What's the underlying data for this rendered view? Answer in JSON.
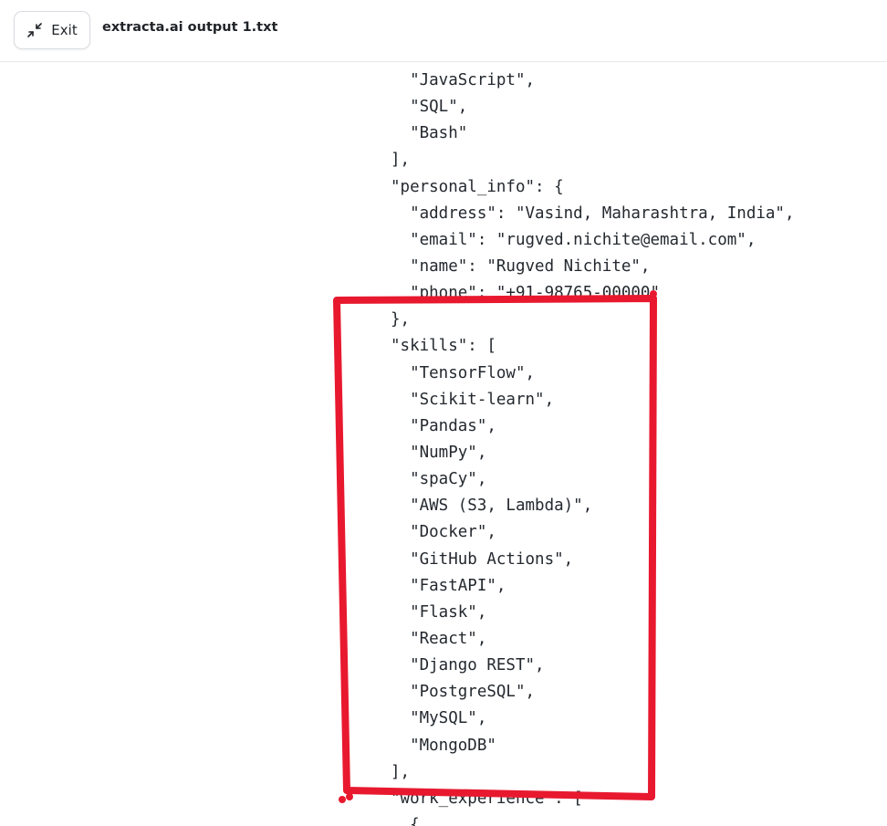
{
  "header": {
    "exit_label": "Exit",
    "exit_icon": "minimize-arrows-icon",
    "file_title": "extracta.ai output 1.txt"
  },
  "file_content": {
    "lines": [
      "  \"JavaScript\",",
      "  \"SQL\",",
      "  \"Bash\"",
      "],",
      "\"personal_info\": {",
      "  \"address\": \"Vasind, Maharashtra, India\",",
      "  \"email\": \"rugved.nichite@email.com\",",
      "  \"name\": \"Rugved Nichite\",",
      "  \"phone\": \"+91-98765-00000\"",
      "},",
      "\"skills\": [",
      "  \"TensorFlow\",",
      "  \"Scikit-learn\",",
      "  \"Pandas\",",
      "  \"NumPy\",",
      "  \"spaCy\",",
      "  \"AWS (S3, Lambda)\",",
      "  \"Docker\",",
      "  \"GitHub Actions\",",
      "  \"FastAPI\",",
      "  \"Flask\",",
      "  \"React\",",
      "  \"Django REST\",",
      "  \"PostgreSQL\",",
      "  \"MySQL\",",
      "  \"MongoDB\"",
      "],",
      "\"work_experience\": [",
      "  {"
    ]
  },
  "annotation": {
    "color": "#e8192f"
  }
}
